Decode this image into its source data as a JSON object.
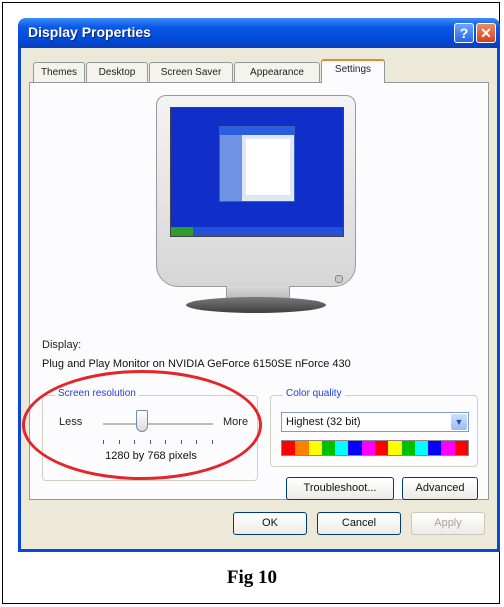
{
  "window": {
    "title": "Display Properties",
    "help_glyph": "?",
    "close_glyph": "✕"
  },
  "tabs": [
    {
      "label": "Themes",
      "active": false
    },
    {
      "label": "Desktop",
      "active": false
    },
    {
      "label": "Screen Saver",
      "active": false
    },
    {
      "label": "Appearance",
      "active": false
    },
    {
      "label": "Settings",
      "active": true
    }
  ],
  "display": {
    "label": "Display:",
    "value": "Plug and Play Monitor on NVIDIA GeForce 6150SE nForce 430"
  },
  "screen_resolution": {
    "label": "Screen resolution",
    "less_label": "Less",
    "more_label": "More",
    "slider_fraction": 0.35,
    "tick_count": 8,
    "value": "1280 by 768 pixels"
  },
  "color_quality": {
    "label": "Color quality",
    "selected": "Highest (32 bit)",
    "arrow_glyph": "▼",
    "spectrum": [
      "#ff0000",
      "#ff8000",
      "#ffff00",
      "#00c000",
      "#00ffff",
      "#0000ff",
      "#ff00ff",
      "#ff0000",
      "#ffff00",
      "#00c000",
      "#00ffff",
      "#0000ff",
      "#ff00ff",
      "#ff0000"
    ]
  },
  "buttons": {
    "troubleshoot": "Troubleshoot...",
    "advanced": "Advanced",
    "ok": "OK",
    "cancel": "Cancel",
    "apply": "Apply"
  },
  "colors": {
    "highlight_ellipse": "#e3262a",
    "titlebar": "#0348d6",
    "active_tab_accent": "#e68b2c"
  },
  "caption": "Fig 10"
}
